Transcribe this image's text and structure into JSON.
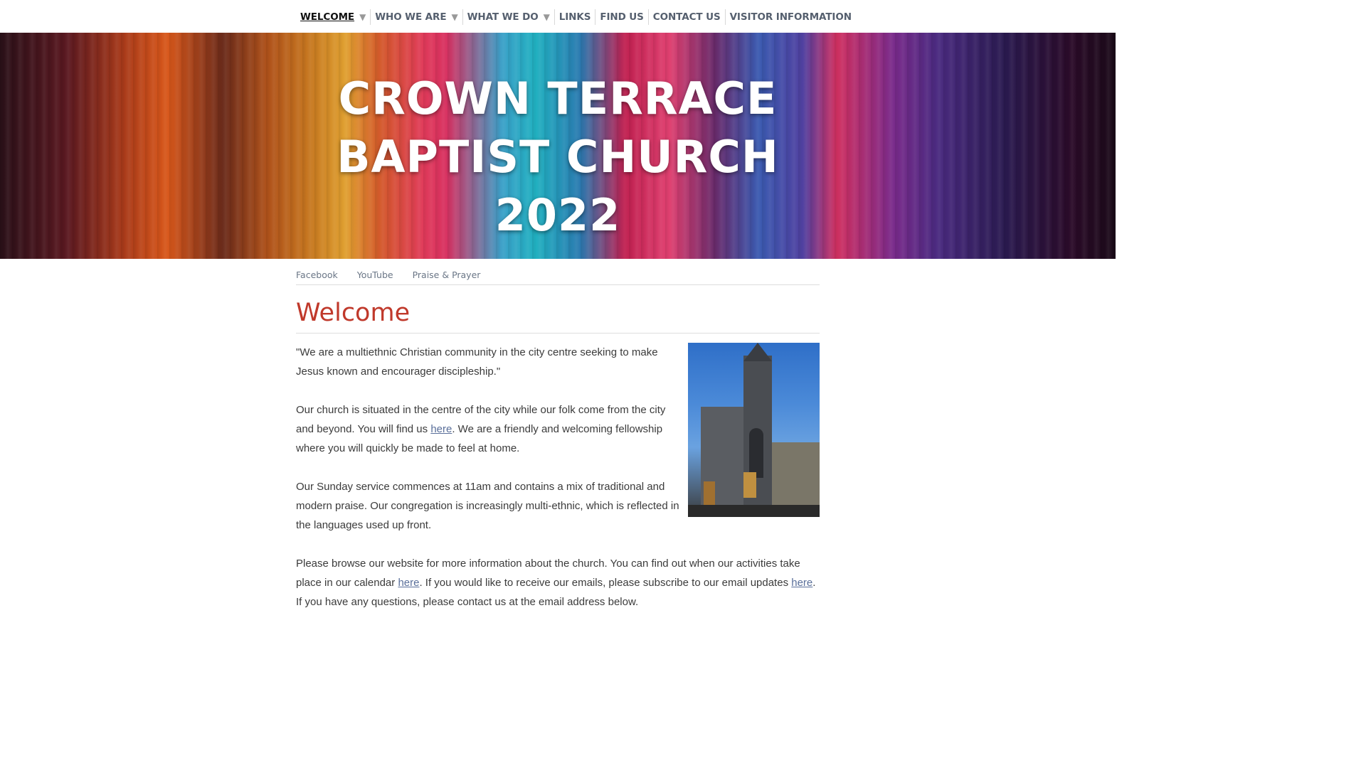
{
  "nav": {
    "items": [
      {
        "label": "WELCOME",
        "has_dropdown": true,
        "active": true
      },
      {
        "label": "WHO WE ARE",
        "has_dropdown": true,
        "active": false
      },
      {
        "label": "WHAT WE DO",
        "has_dropdown": true,
        "active": false
      },
      {
        "label": "LINKS",
        "has_dropdown": false,
        "active": false
      },
      {
        "label": "FIND US",
        "has_dropdown": false,
        "active": false
      },
      {
        "label": "CONTACT US",
        "has_dropdown": false,
        "active": false
      },
      {
        "label": "VISITOR INFORMATION",
        "has_dropdown": false,
        "active": false
      }
    ],
    "caret": "▼"
  },
  "banner": {
    "title_lines": [
      "CROWN TERRACE",
      "BAPTIST CHURCH",
      "2022"
    ]
  },
  "subnav": {
    "links": [
      "Facebook",
      "YouTube",
      "Praise & Prayer"
    ]
  },
  "page": {
    "heading": "Welcome",
    "photo_icon": "church-photo",
    "p1": "\"We are a multiethnic Christian community in the city centre seeking to make Jesus known and encourager discipleship.\"",
    "p2": {
      "before": "Our church is situated in the centre of the city while our folk come from the city and beyond.  You will find us ",
      "link": "here",
      "after": ".  We are a friendly and welcoming fellowship where you will quickly be made to feel at home."
    },
    "p3": "Our Sunday service commences at 11am and contains a mix of traditional and modern praise. Our congregation is increasingly multi-ethnic, which is reflected in the languages used up front.",
    "p4": {
      "part1": "Please browse our website for more information about the church.  You can find out when our activities take place in our calendar ",
      "link1": "here",
      "part2": ". If you would like to receive our emails, please subscribe to our email updates ",
      "link2": "here",
      "part3": ". If you have any questions, please contact us at the email address below."
    }
  },
  "colors": {
    "heading": "#c0392b",
    "nav_text": "#555f6e",
    "link": "#5a6f9a"
  }
}
